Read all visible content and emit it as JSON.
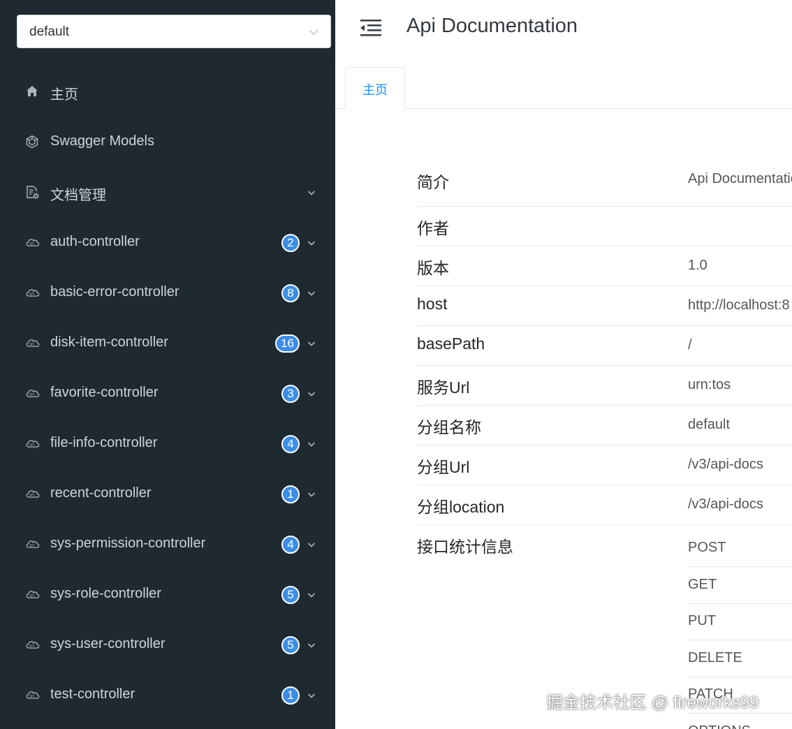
{
  "group_select": {
    "value": "default"
  },
  "header": {
    "title": "Api Documentation"
  },
  "tabs": [
    {
      "label": "主页"
    }
  ],
  "sidebar": {
    "items": [
      {
        "label": "主页",
        "icon": "home-icon"
      },
      {
        "label": "Swagger Models",
        "icon": "models-icon"
      },
      {
        "label": "文档管理",
        "icon": "doc-settings-icon",
        "expandable": true
      },
      {
        "label": "auth-controller",
        "icon": "api-cloud-icon",
        "badge": "2"
      },
      {
        "label": "basic-error-controller",
        "icon": "api-cloud-icon",
        "badge": "8"
      },
      {
        "label": "disk-item-controller",
        "icon": "api-cloud-icon",
        "badge": "16"
      },
      {
        "label": "favorite-controller",
        "icon": "api-cloud-icon",
        "badge": "3"
      },
      {
        "label": "file-info-controller",
        "icon": "api-cloud-icon",
        "badge": "4"
      },
      {
        "label": "recent-controller",
        "icon": "api-cloud-icon",
        "badge": "1"
      },
      {
        "label": "sys-permission-controller",
        "icon": "api-cloud-icon",
        "badge": "4"
      },
      {
        "label": "sys-role-controller",
        "icon": "api-cloud-icon",
        "badge": "5"
      },
      {
        "label": "sys-user-controller",
        "icon": "api-cloud-icon",
        "badge": "5"
      },
      {
        "label": "test-controller",
        "icon": "api-cloud-icon",
        "badge": "1"
      }
    ]
  },
  "info": {
    "rows": [
      {
        "key": "简介",
        "value": "Api Documentation"
      },
      {
        "key": "作者",
        "value": ""
      },
      {
        "key": "版本",
        "value": "1.0"
      },
      {
        "key": "host",
        "value": "http://localhost:8"
      },
      {
        "key": "basePath",
        "value": "/"
      },
      {
        "key": "服务Url",
        "value": "urn:tos"
      },
      {
        "key": "分组名称",
        "value": "default"
      },
      {
        "key": "分组Url",
        "value": "/v3/api-docs"
      },
      {
        "key": "分组location",
        "value": "/v3/api-docs"
      }
    ],
    "stats_label": "接口统计信息",
    "methods": [
      "POST",
      "GET",
      "PUT",
      "DELETE",
      "PATCH",
      "OPTIONS"
    ]
  },
  "watermark": "掘金技术社区 @ fireworks99",
  "colors": {
    "sidebar_bg": "#1f2a30",
    "badge": "#3b8ee8",
    "accent": "#1890ff"
  }
}
